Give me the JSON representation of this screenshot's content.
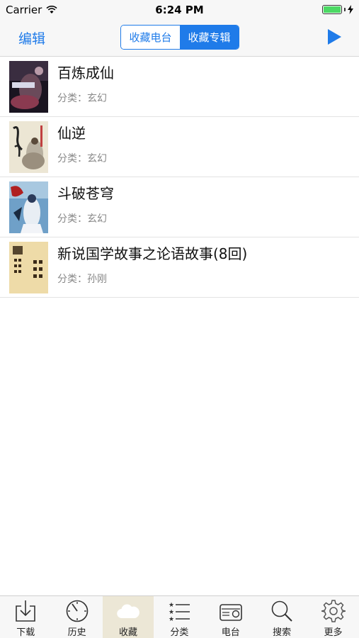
{
  "status_bar": {
    "carrier": "Carrier",
    "time": "6:24 PM"
  },
  "nav": {
    "edit_label": "编辑",
    "segments": [
      "收藏电台",
      "收藏专辑"
    ],
    "selected_segment": "收藏专辑"
  },
  "list": [
    {
      "title": "百炼成仙",
      "meta": "分类：玄幻"
    },
    {
      "title": "仙逆",
      "meta": "分类：玄幻"
    },
    {
      "title": "斗破苍穹",
      "meta": "分类：玄幻"
    },
    {
      "title": "新说国学故事之论语故事(8回)",
      "meta": "分类：孙刚"
    }
  ],
  "tabs": [
    {
      "label": "下载",
      "icon": "download-icon"
    },
    {
      "label": "历史",
      "icon": "clock-icon"
    },
    {
      "label": "收藏",
      "icon": "cloud-icon",
      "selected": true
    },
    {
      "label": "分类",
      "icon": "list-icon"
    },
    {
      "label": "电台",
      "icon": "radio-icon"
    },
    {
      "label": "搜索",
      "icon": "search-icon"
    },
    {
      "label": "更多",
      "icon": "gear-icon"
    }
  ],
  "colors": {
    "accent": "#1f7be9",
    "selected_tab_bg": "#ece7d6"
  }
}
